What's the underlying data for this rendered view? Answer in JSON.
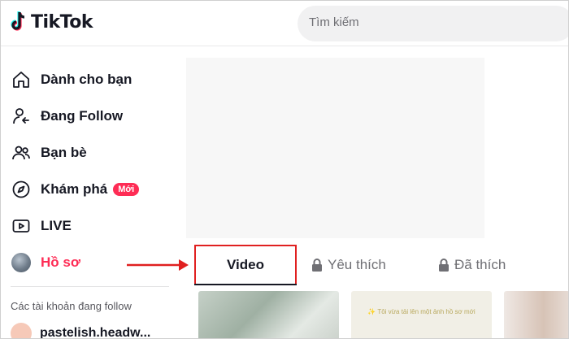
{
  "header": {
    "logo_text": "TikTok",
    "search_placeholder": "Tìm kiếm"
  },
  "sidebar": {
    "items": [
      {
        "label": "Dành cho bạn",
        "icon": "home-icon"
      },
      {
        "label": "Đang Follow",
        "icon": "following-icon"
      },
      {
        "label": "Bạn bè",
        "icon": "friends-icon"
      },
      {
        "label": "Khám phá",
        "icon": "compass-icon",
        "badge": "Mới"
      },
      {
        "label": "LIVE",
        "icon": "live-icon"
      },
      {
        "label": "Hồ sơ",
        "icon": "avatar",
        "active": true
      }
    ],
    "following_title": "Các tài khoản đang follow",
    "following": [
      {
        "name": "pastelish.headw..."
      }
    ]
  },
  "profile": {
    "tabs": [
      {
        "label": "Video",
        "selected": true
      },
      {
        "label": "Yêu thích",
        "icon": "lock-icon"
      },
      {
        "label": "Đã thích",
        "icon": "lock-icon"
      }
    ],
    "thumbnails": [
      {
        "caption": ""
      },
      {
        "caption": "✨ Tôi vừa tải lên một ảnh hồ sơ mới"
      },
      {
        "caption": ""
      }
    ]
  },
  "colors": {
    "accent": "#fe2c55",
    "highlight_box": "#e02020",
    "text": "#161823"
  }
}
